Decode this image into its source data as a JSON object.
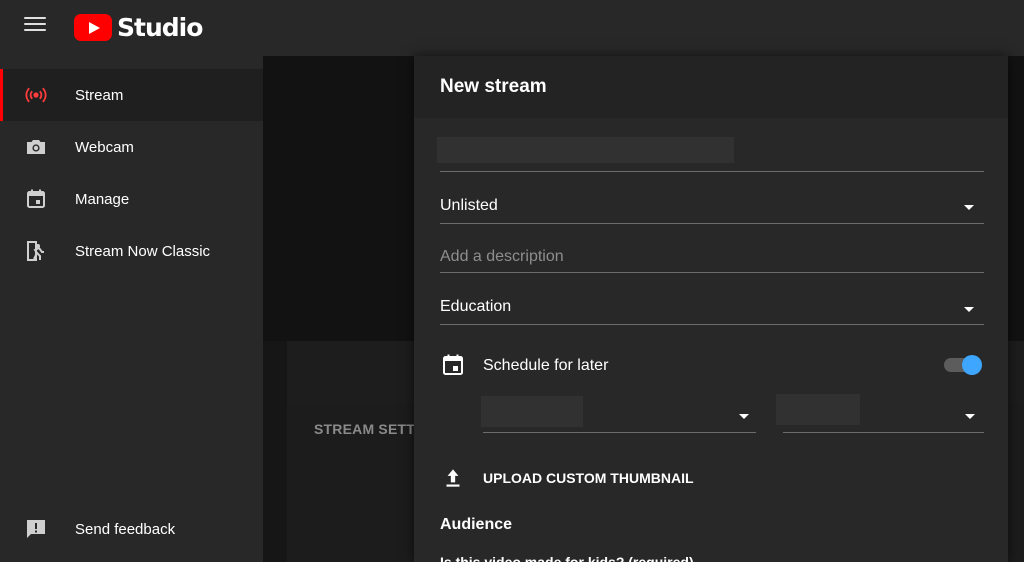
{
  "app": {
    "logo_text": "Studio"
  },
  "sidebar": {
    "items": [
      {
        "label": "Stream",
        "icon": "live-broadcast-icon",
        "active": true
      },
      {
        "label": "Webcam",
        "icon": "camera-icon",
        "active": false
      },
      {
        "label": "Manage",
        "icon": "calendar-icon",
        "active": false
      },
      {
        "label": "Stream Now Classic",
        "icon": "stream-now-classic-icon",
        "active": false
      }
    ],
    "feedback_label": "Send feedback"
  },
  "background": {
    "stream_settings_label": "STREAM SETT"
  },
  "dialog": {
    "title": "New stream",
    "title_field_value": "",
    "visibility_value": "Unlisted",
    "description_placeholder": "Add a description",
    "category_value": "Education",
    "schedule_label": "Schedule for later",
    "schedule_enabled": true,
    "upload_thumbnail_label": "UPLOAD CUSTOM THUMBNAIL",
    "audience_title": "Audience",
    "audience_question_partial": "Is this video made for kids? (required)"
  },
  "colors": {
    "brand_red": "#ff0000",
    "toggle_accent": "#3ea6ff",
    "sidebar_bg": "#282828",
    "dialog_bg": "#282828"
  }
}
